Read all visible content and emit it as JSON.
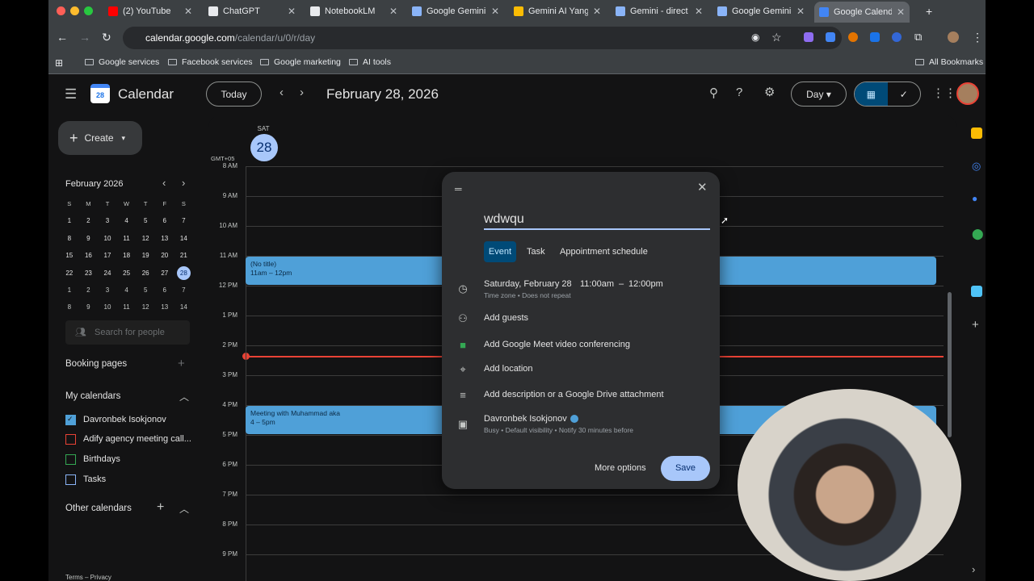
{
  "browser": {
    "tabs": [
      {
        "label": "(2) YouTube",
        "color": "#ff0000"
      },
      {
        "label": "ChatGPT",
        "color": "#e8eaed"
      },
      {
        "label": "NotebookLM",
        "color": "#e8eaed"
      },
      {
        "label": "Google Gemini",
        "color": "#8ab4f8"
      },
      {
        "label": "Gemini AI Yangi",
        "color": "#fbbc04"
      },
      {
        "label": "Gemini - direct a",
        "color": "#8ab4f8"
      },
      {
        "label": "Google Gemini",
        "color": "#8ab4f8"
      },
      {
        "label": "Google Calenda",
        "color": "#4285f4"
      }
    ],
    "url_host": "calendar.google.com",
    "url_path": "/calendar/u/0/r/day",
    "bookmarks": [
      "Google services",
      "Facebook services",
      "Google marketing",
      "AI tools"
    ],
    "all_bookmarks": "All Bookmarks",
    "new_tab": "+"
  },
  "header": {
    "app": "Calendar",
    "logo_day": "28",
    "today": "Today",
    "date": "February 28, 2026",
    "view": "Day"
  },
  "sidebar": {
    "create": "Create",
    "month": "February 2026",
    "weekdays": [
      "S",
      "M",
      "T",
      "W",
      "T",
      "F",
      "S"
    ],
    "weeks": [
      [
        "1",
        "2",
        "3",
        "4",
        "5",
        "6",
        "7"
      ],
      [
        "8",
        "9",
        "10",
        "11",
        "12",
        "13",
        "14"
      ],
      [
        "15",
        "16",
        "17",
        "18",
        "19",
        "20",
        "21"
      ],
      [
        "22",
        "23",
        "24",
        "25",
        "26",
        "27",
        "28"
      ],
      [
        "1",
        "2",
        "3",
        "4",
        "5",
        "6",
        "7"
      ],
      [
        "8",
        "9",
        "10",
        "11",
        "12",
        "13",
        "14"
      ]
    ],
    "search_placeholder": "Search for people",
    "booking": "Booking pages",
    "my_calendars": "My calendars",
    "calendars": [
      {
        "label": "Davronbek Isokjonov",
        "color": "#4fa0d8",
        "checked": true
      },
      {
        "label": "Adify agency meeting call...",
        "color": "#e94235",
        "checked": false
      },
      {
        "label": "Birthdays",
        "color": "#34a853",
        "checked": false
      },
      {
        "label": "Tasks",
        "color": "#8ab4f8",
        "checked": false
      }
    ],
    "other_calendars": "Other calendars",
    "footer": "Terms – Privacy"
  },
  "day": {
    "dow": "SAT",
    "num": "28",
    "tz": "GMT+05",
    "hours": [
      "8 AM",
      "9 AM",
      "10 AM",
      "11 AM",
      "12 PM",
      "1 PM",
      "2 PM",
      "3 PM",
      "4 PM",
      "5 PM",
      "6 PM",
      "7 PM",
      "8 PM",
      "9 PM"
    ],
    "events": [
      {
        "title": "(No title)",
        "time": "11am – 12pm"
      },
      {
        "title": "Meeting with Muhammad aka",
        "time": "4 – 5pm"
      }
    ]
  },
  "popup": {
    "title_value": "wdwqu",
    "tabs": [
      "Event",
      "Task",
      "Appointment schedule"
    ],
    "date": "Saturday, February 28",
    "start": "11:00am",
    "dash": "–",
    "end": "12:00pm",
    "tz_note": "Time zone • Does not repeat",
    "guests": "Add guests",
    "meet": "Add Google Meet video conferencing",
    "location": "Add location",
    "description": "Add description or a Google Drive attachment",
    "owner": "Davronbek Isokjonov",
    "owner_note": "Busy • Default visibility • Notify 30 minutes before",
    "more": "More options",
    "save": "Save"
  }
}
